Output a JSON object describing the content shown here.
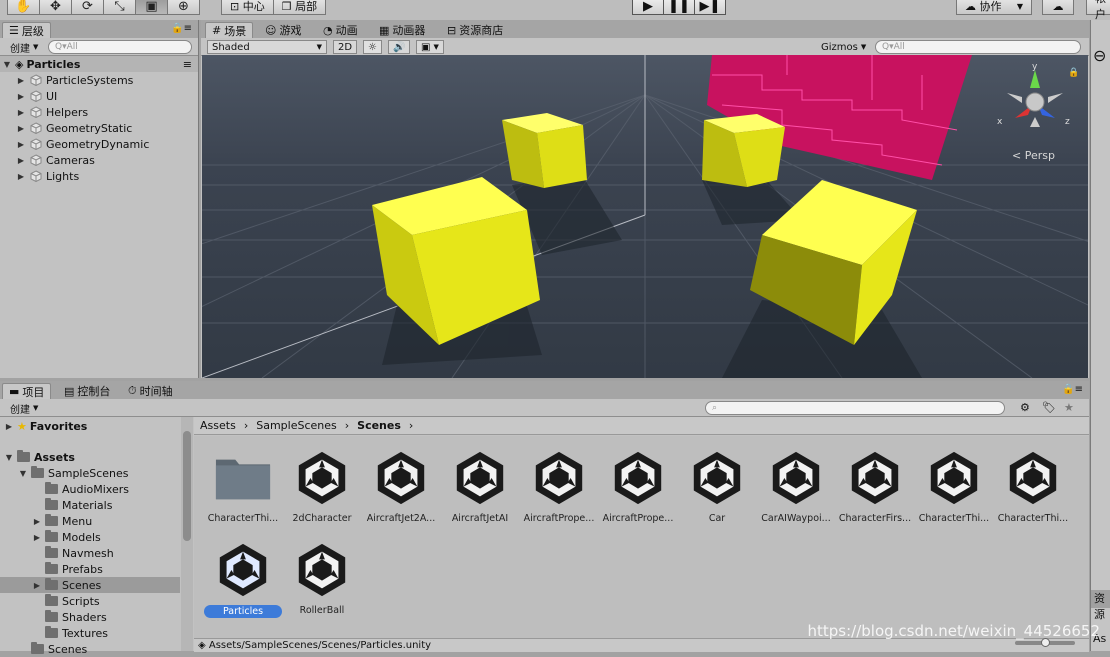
{
  "toolbar": {
    "tools": [
      "hand-icon",
      "move-icon",
      "rotate-icon",
      "scale-icon",
      "rect-icon",
      "transform-icon"
    ],
    "pivot_center": "中心",
    "pivot_local": "局部",
    "collab": "协作",
    "account_partial": "帐户"
  },
  "hierarchy": {
    "tab": "层级",
    "create": "创建",
    "search_placeholder": "Q▾All",
    "scene_name": "Particles",
    "items": [
      "ParticleSystems",
      "UI",
      "Helpers",
      "GeometryStatic",
      "GeometryDynamic",
      "Cameras",
      "Lights"
    ]
  },
  "scene": {
    "tabs": [
      "场景",
      "游戏",
      "动画",
      "动画器",
      "资源商店"
    ],
    "shading": "Shaded",
    "mode_2d": "2D",
    "gizmos": "Gizmos",
    "search_placeholder": "Q▾All",
    "persp": "Persp",
    "axes": {
      "x": "x",
      "y": "y",
      "z": "z"
    }
  },
  "project": {
    "tabs": [
      "项目",
      "控制台",
      "时间轴"
    ],
    "create": "创建",
    "favorites": "Favorites",
    "assets": "Assets",
    "tree": [
      {
        "label": "SampleScenes",
        "depth": 1,
        "arrow": "▼"
      },
      {
        "label": "AudioMixers",
        "depth": 2,
        "arrow": ""
      },
      {
        "label": "Materials",
        "depth": 2,
        "arrow": ""
      },
      {
        "label": "Menu",
        "depth": 2,
        "arrow": "▶"
      },
      {
        "label": "Models",
        "depth": 2,
        "arrow": "▶"
      },
      {
        "label": "Navmesh",
        "depth": 2,
        "arrow": ""
      },
      {
        "label": "Prefabs",
        "depth": 2,
        "arrow": ""
      },
      {
        "label": "Scenes",
        "depth": 2,
        "arrow": "▶"
      },
      {
        "label": "Scripts",
        "depth": 2,
        "arrow": ""
      },
      {
        "label": "Shaders",
        "depth": 2,
        "arrow": ""
      },
      {
        "label": "Textures",
        "depth": 2,
        "arrow": ""
      },
      {
        "label": "Scenes",
        "depth": 1,
        "arrow": ""
      }
    ],
    "breadcrumb": [
      "Assets",
      "SampleScenes",
      "Scenes"
    ],
    "assets_row1": [
      "CharacterThi...",
      "2dCharacter",
      "AircraftJet2A...",
      "AircraftJetAI",
      "AircraftPrope...",
      "AircraftPrope...",
      "Car",
      "CarAIWaypoi...",
      "CharacterFirs...",
      "CharacterThi...",
      "CharacterThi..."
    ],
    "assets_row2": [
      "Particles",
      "RollerBall"
    ],
    "status_path": "Assets/SampleScenes/Scenes/Particles.unity"
  },
  "inspector": {
    "partial_label": "资源",
    "partial_label2": "As"
  },
  "watermark": "https://blog.csdn.net/weixin_44526652",
  "colors": {
    "cube": "#e6e619",
    "wall": "#c8125f",
    "selected": "#3d7bd9"
  }
}
